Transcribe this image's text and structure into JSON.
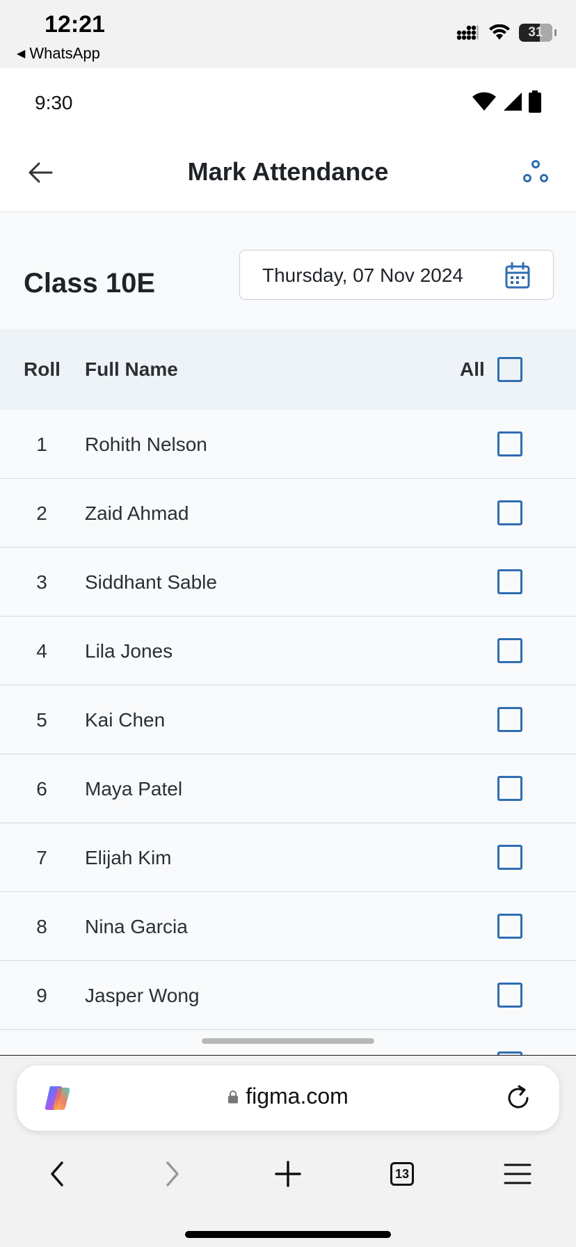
{
  "ios_status": {
    "time": "12:21",
    "back_app": "WhatsApp",
    "battery": "31"
  },
  "app": {
    "android_status": {
      "time": "9:30"
    },
    "appbar": {
      "title": "Mark Attendance"
    },
    "class_name": "Class 10E",
    "date": "Thursday, 07 Nov 2024",
    "table": {
      "headers": {
        "roll": "Roll",
        "name": "Full Name",
        "all": "All"
      },
      "rows": [
        {
          "roll": "1",
          "name": "Rohith Nelson",
          "checked": false
        },
        {
          "roll": "2",
          "name": "Zaid Ahmad",
          "checked": false
        },
        {
          "roll": "3",
          "name": "Siddhant Sable",
          "checked": false
        },
        {
          "roll": "4",
          "name": "Lila Jones",
          "checked": false
        },
        {
          "roll": "5",
          "name": "Kai Chen",
          "checked": false
        },
        {
          "roll": "6",
          "name": "Maya Patel",
          "checked": false
        },
        {
          "roll": "7",
          "name": "Elijah Kim",
          "checked": false
        },
        {
          "roll": "8",
          "name": "Nina Garcia",
          "checked": false
        },
        {
          "roll": "9",
          "name": "Jasper Wong",
          "checked": false
        }
      ]
    }
  },
  "browser": {
    "url": "figma.com",
    "tab_count": "13",
    "icons": [
      "copilot-icon",
      "lock-icon",
      "reload-icon",
      "back-icon",
      "forward-icon",
      "new-tab-icon",
      "tabs-icon",
      "menu-icon"
    ]
  },
  "colors": {
    "accent": "#2f6db3",
    "header_bg": "#eef3f8",
    "row_bg": "#f8fafc",
    "divider": "#d5d9de"
  }
}
